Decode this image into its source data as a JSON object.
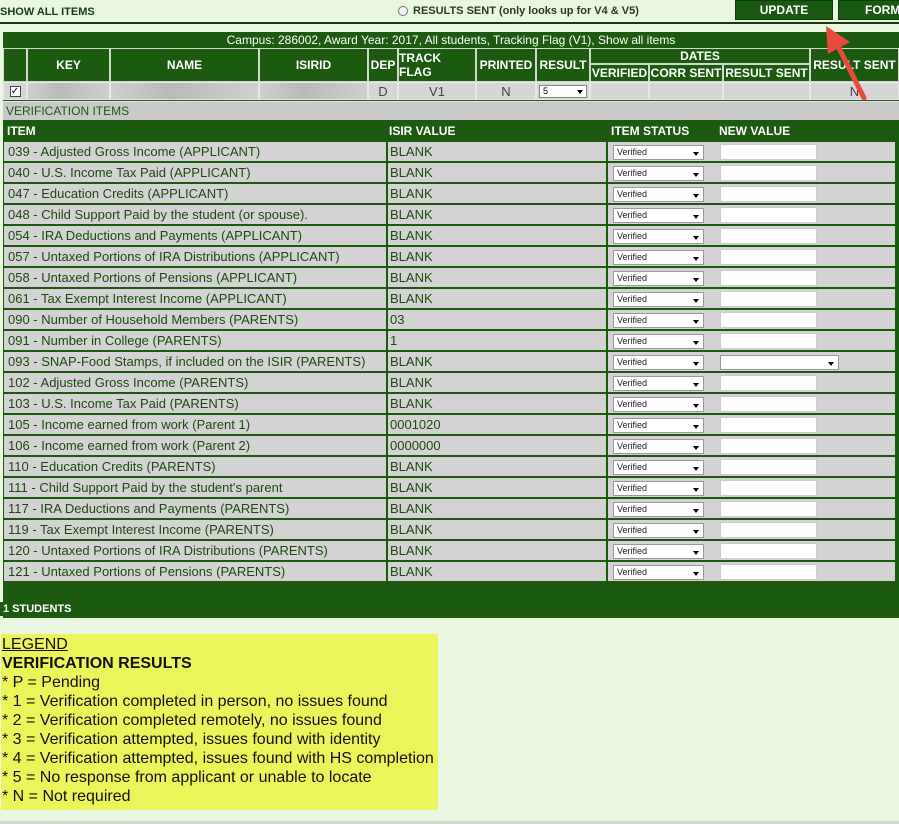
{
  "topbar": {
    "show_all": "SHOW ALL ITEMS",
    "results_sent": "RESULTS SENT (only looks up for V4 & V5)",
    "update": "UPDATE",
    "form": "FORM"
  },
  "banner": "Campus: 286002, Award Year: 2017, All students, Tracking Flag (V1), Show all items",
  "headers": {
    "key": "KEY",
    "name": "NAME",
    "isirid": "ISIRID",
    "dep": "DEP",
    "track_flag": "TRACK FLAG",
    "printed": "PRINTED",
    "result": "RESULT",
    "dates": "DATES",
    "verified": "VERIFIED",
    "corr_sent": "CORR SENT",
    "result_sent": "RESULT SENT",
    "result_sent2": "RESULT SENT"
  },
  "student": {
    "checked": "✓",
    "dep": "D",
    "track_flag": "V1",
    "printed": "N",
    "result": "5",
    "result_sent2": "N"
  },
  "verification": {
    "title": "VERIFICATION ITEMS",
    "col_item": "ITEM",
    "col_isir": "ISIR VALUE",
    "col_status": "ITEM STATUS",
    "col_new": "NEW VALUE",
    "items": [
      {
        "item": "039 - Adjusted Gross Income (APPLICANT)",
        "isir": "BLANK",
        "status": "Verified",
        "new_type": "input"
      },
      {
        "item": "040 - U.S. Income Tax Paid (APPLICANT)",
        "isir": "BLANK",
        "status": "Verified",
        "new_type": "input"
      },
      {
        "item": "047 - Education Credits (APPLICANT)",
        "isir": "BLANK",
        "status": "Verified",
        "new_type": "input"
      },
      {
        "item": "048 - Child Support Paid by the student (or spouse).",
        "isir": "BLANK",
        "status": "Verified",
        "new_type": "input"
      },
      {
        "item": "054 - IRA Deductions and Payments (APPLICANT)",
        "isir": "BLANK",
        "status": "Verified",
        "new_type": "input"
      },
      {
        "item": "057 - Untaxed Portions of IRA Distributions (APPLICANT)",
        "isir": "BLANK",
        "status": "Verified",
        "new_type": "input"
      },
      {
        "item": "058 - Untaxed Portions of Pensions (APPLICANT)",
        "isir": "BLANK",
        "status": "Verified",
        "new_type": "input"
      },
      {
        "item": "061 - Tax Exempt Interest Income (APPLICANT)",
        "isir": "BLANK",
        "status": "Verified",
        "new_type": "input"
      },
      {
        "item": "090 - Number of Household Members (PARENTS)",
        "isir": "03",
        "status": "Verified",
        "new_type": "input"
      },
      {
        "item": "091 - Number in College (PARENTS)",
        "isir": "1",
        "status": "Verified",
        "new_type": "input"
      },
      {
        "item": "093 - SNAP-Food Stamps, if included on the ISIR (PARENTS)",
        "isir": "BLANK",
        "status": "Verified",
        "new_type": "select"
      },
      {
        "item": "102 - Adjusted Gross Income (PARENTS)",
        "isir": "BLANK",
        "status": "Verified",
        "new_type": "input"
      },
      {
        "item": "103 - U.S. Income Tax Paid (PARENTS)",
        "isir": "BLANK",
        "status": "Verified",
        "new_type": "input"
      },
      {
        "item": "105 - Income earned from work (Parent 1)",
        "isir": "0001020",
        "status": "Verified",
        "new_type": "input"
      },
      {
        "item": "106 - Income earned from work (Parent 2)",
        "isir": "0000000",
        "status": "Verified",
        "new_type": "input"
      },
      {
        "item": "110 - Education Credits (PARENTS)",
        "isir": "BLANK",
        "status": "Verified",
        "new_type": "input"
      },
      {
        "item": "111 - Child Support Paid by the student's parent",
        "isir": "BLANK",
        "status": "Verified",
        "new_type": "input"
      },
      {
        "item": "117 - IRA Deductions and Payments (PARENTS)",
        "isir": "BLANK",
        "status": "Verified",
        "new_type": "input"
      },
      {
        "item": "119 - Tax Exempt Interest Income (PARENTS)",
        "isir": "BLANK",
        "status": "Verified",
        "new_type": "input"
      },
      {
        "item": "120 - Untaxed Portions of IRA Distributions (PARENTS)",
        "isir": "BLANK",
        "status": "Verified",
        "new_type": "input"
      },
      {
        "item": "121 - Untaxed Portions of Pensions (PARENTS)",
        "isir": "BLANK",
        "status": "Verified",
        "new_type": "input"
      }
    ]
  },
  "students_count": "1 STUDENTS",
  "legend": {
    "title": "LEGEND",
    "heading": "VERIFICATION RESULTS",
    "lines": [
      "* P = Pending",
      "* 1 = Verification completed in person, no issues found",
      "* 2 = Verification completed remotely, no issues found",
      "* 3 = Verification attempted, issues found with identity",
      "* 4 = Verification attempted, issues found with HS completion",
      "* 5 = No response from applicant or unable to locate",
      "* N = Not required"
    ]
  },
  "colors": {
    "header_green": "#1b5a0f",
    "row_gray": "#d3d3d3",
    "legend_yellow": "#ebf55a",
    "annotation_red": "#e84a3c"
  }
}
